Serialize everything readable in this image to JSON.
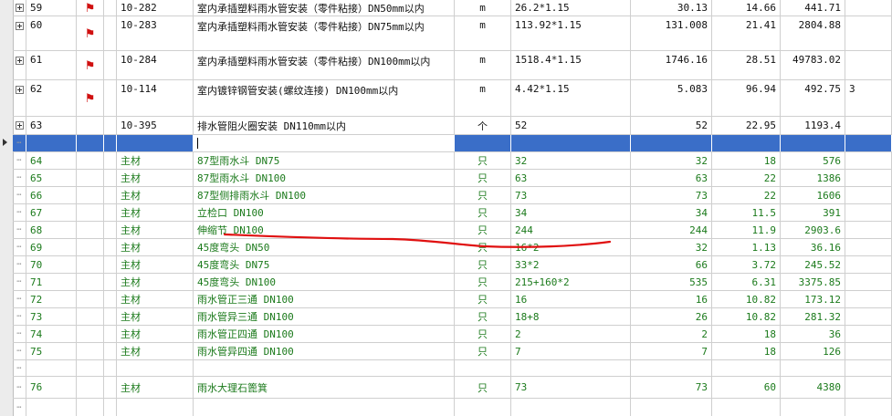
{
  "rows_main": [
    {
      "seq": "59",
      "code": "10-282",
      "name": "室内承插塑料雨水管安装（零件粘接）DN50mm以内",
      "unit": "m",
      "formula": "26.2*1.15",
      "qty": "30.13",
      "price": "14.66",
      "total": "441.71"
    },
    {
      "seq": "60",
      "code": "10-283",
      "name": "室内承插塑料雨水管安装（零件粘接）DN75mm以内",
      "unit": "m",
      "formula": "113.92*1.15",
      "qty": "131.008",
      "price": "21.41",
      "total": "2804.88"
    },
    {
      "seq": "61",
      "code": "10-284",
      "name": "室内承插塑料雨水管安装（零件粘接）DN100mm以内",
      "unit": "m",
      "formula": "1518.4*1.15",
      "qty": "1746.16",
      "price": "28.51",
      "total": "49783.02"
    },
    {
      "seq": "62",
      "code": "10-114",
      "name": "室内镀锌钢管安装(螺纹连接)  DN100mm以内",
      "unit": "m",
      "formula": "4.42*1.15",
      "qty": "5.083",
      "price": "96.94",
      "total": "492.75",
      "extra": "3"
    },
    {
      "seq": "63",
      "code": "10-395",
      "name": "排水管阻火圈安装 DN110mm以内",
      "unit": "个",
      "formula": "52",
      "qty": "52",
      "price": "22.95",
      "total": "1193.4"
    }
  ],
  "rows_material": [
    {
      "seq": "64",
      "code": "主材",
      "name": "87型雨水斗 DN75",
      "unit": "只",
      "formula": "32",
      "qty": "32",
      "price": "18",
      "total": "576"
    },
    {
      "seq": "65",
      "code": "主材",
      "name": "87型雨水斗 DN100",
      "unit": "只",
      "formula": "63",
      "qty": "63",
      "price": "22",
      "total": "1386"
    },
    {
      "seq": "66",
      "code": "主材",
      "name": "87型侧排雨水斗 DN100",
      "unit": "只",
      "formula": "73",
      "qty": "73",
      "price": "22",
      "total": "1606"
    },
    {
      "seq": "67",
      "code": "主材",
      "name": "立检口 DN100",
      "unit": "只",
      "formula": "34",
      "qty": "34",
      "price": "11.5",
      "total": "391"
    },
    {
      "seq": "68",
      "code": "主材",
      "name": "伸缩节 DN100",
      "unit": "只",
      "formula": "244",
      "qty": "244",
      "price": "11.9",
      "total": "2903.6"
    },
    {
      "seq": "69",
      "code": "主材",
      "name": "45度弯头 DN50",
      "unit": "只",
      "formula": "16*2",
      "qty": "32",
      "price": "1.13",
      "total": "36.16"
    },
    {
      "seq": "70",
      "code": "主材",
      "name": "45度弯头 DN75",
      "unit": "只",
      "formula": "33*2",
      "qty": "66",
      "price": "3.72",
      "total": "245.52"
    },
    {
      "seq": "71",
      "code": "主材",
      "name": "45度弯头 DN100",
      "unit": "只",
      "formula": "215+160*2",
      "qty": "535",
      "price": "6.31",
      "total": "3375.85"
    },
    {
      "seq": "72",
      "code": "主材",
      "name": "雨水管正三通 DN100",
      "unit": "只",
      "formula": "16",
      "qty": "16",
      "price": "10.82",
      "total": "173.12"
    },
    {
      "seq": "73",
      "code": "主材",
      "name": "雨水管异三通 DN100",
      "unit": "只",
      "formula": "18+8",
      "qty": "26",
      "price": "10.82",
      "total": "281.32"
    },
    {
      "seq": "74",
      "code": "主材",
      "name": "雨水管正四通 DN100",
      "unit": "只",
      "formula": "2",
      "qty": "2",
      "price": "18",
      "total": "36"
    },
    {
      "seq": "75",
      "code": "主材",
      "name": "雨水管异四通 DN100",
      "unit": "只",
      "formula": "7",
      "qty": "7",
      "price": "18",
      "total": "126"
    },
    {
      "seq": "76",
      "code": "主材",
      "name": "雨水大理石篦箕",
      "unit": "只",
      "formula": "73",
      "qty": "73",
      "price": "60",
      "total": "4380"
    }
  ],
  "colors": {
    "selection": "#3a6ec8",
    "material_text": "#1b7a1b",
    "flag": "#d01010",
    "annotation": "#e01010"
  }
}
